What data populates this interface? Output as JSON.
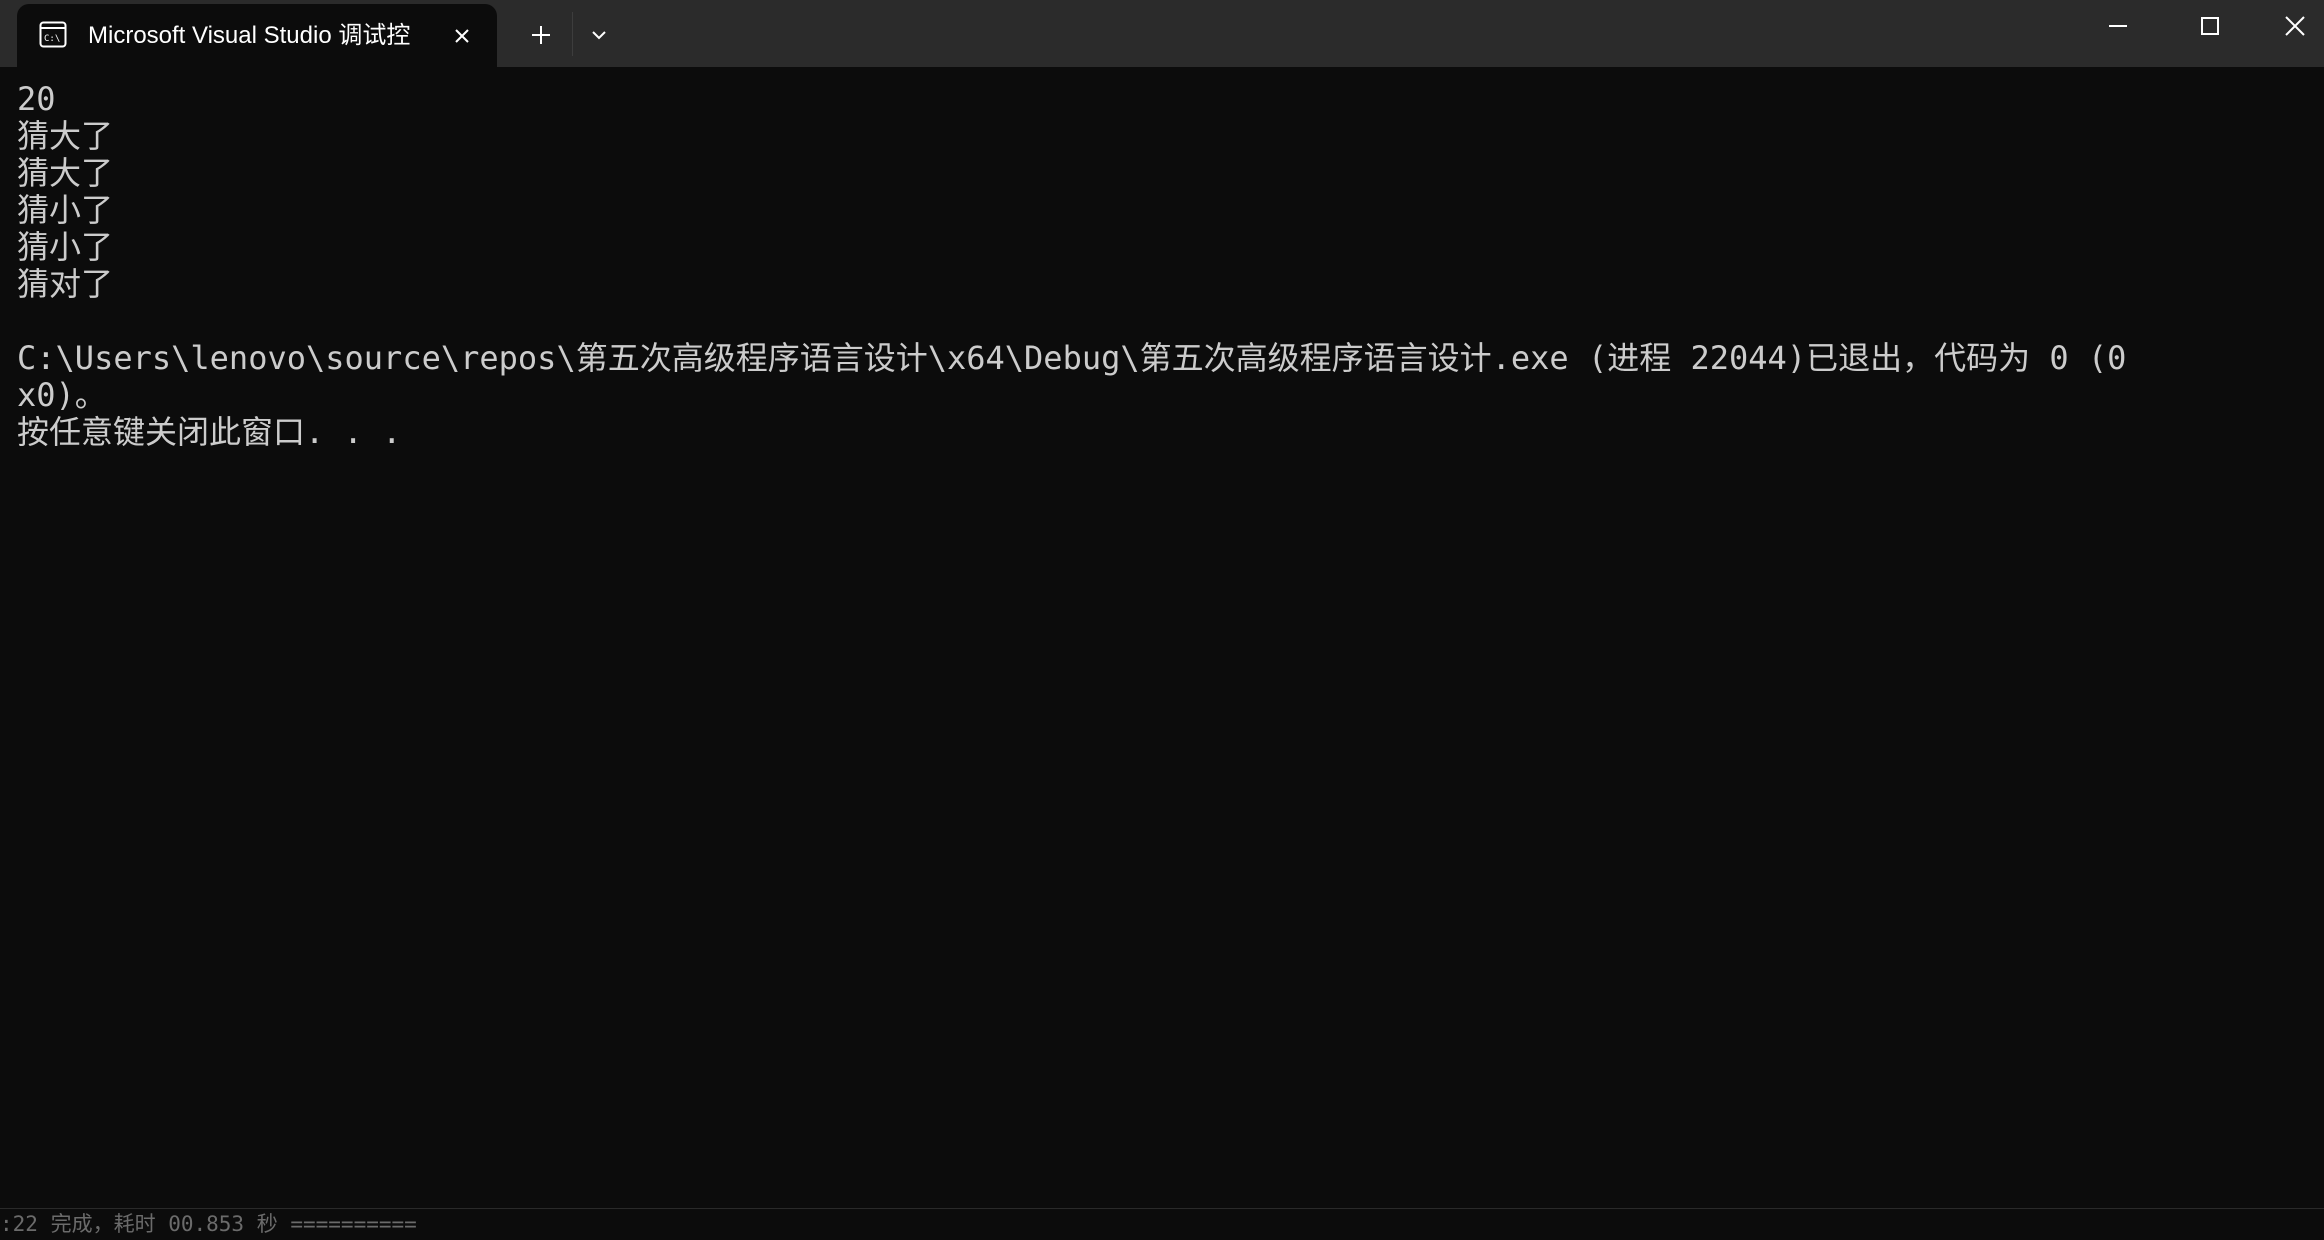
{
  "window": {
    "tab_title": "Microsoft Visual Studio 调试控",
    "icons": {
      "tab": "console-app-icon",
      "close_tab": "close-icon",
      "new_tab": "plus-icon",
      "dropdown": "chevron-down-icon",
      "minimize": "minimize-icon",
      "maximize": "maximize-icon",
      "close_window": "close-icon"
    },
    "colors": {
      "titlebar_bg": "#2b2b2b",
      "console_bg": "#0c0c0c",
      "console_text": "#cccccc",
      "tab_text": "#ffffff"
    }
  },
  "console": {
    "lines": [
      "20",
      "猜大了",
      "猜大了",
      "猜小了",
      "猜小了",
      "猜对了",
      "",
      "C:\\Users\\lenovo\\source\\repos\\第五次高级程序语言设计\\x64\\Debug\\第五次高级程序语言设计.exe (进程 22044)已退出，代码为 0 (0",
      "x0)。",
      "按任意键关闭此窗口. . ."
    ]
  },
  "footer": {
    "text": ":22 完成，耗时 00.853 秒 =========="
  }
}
